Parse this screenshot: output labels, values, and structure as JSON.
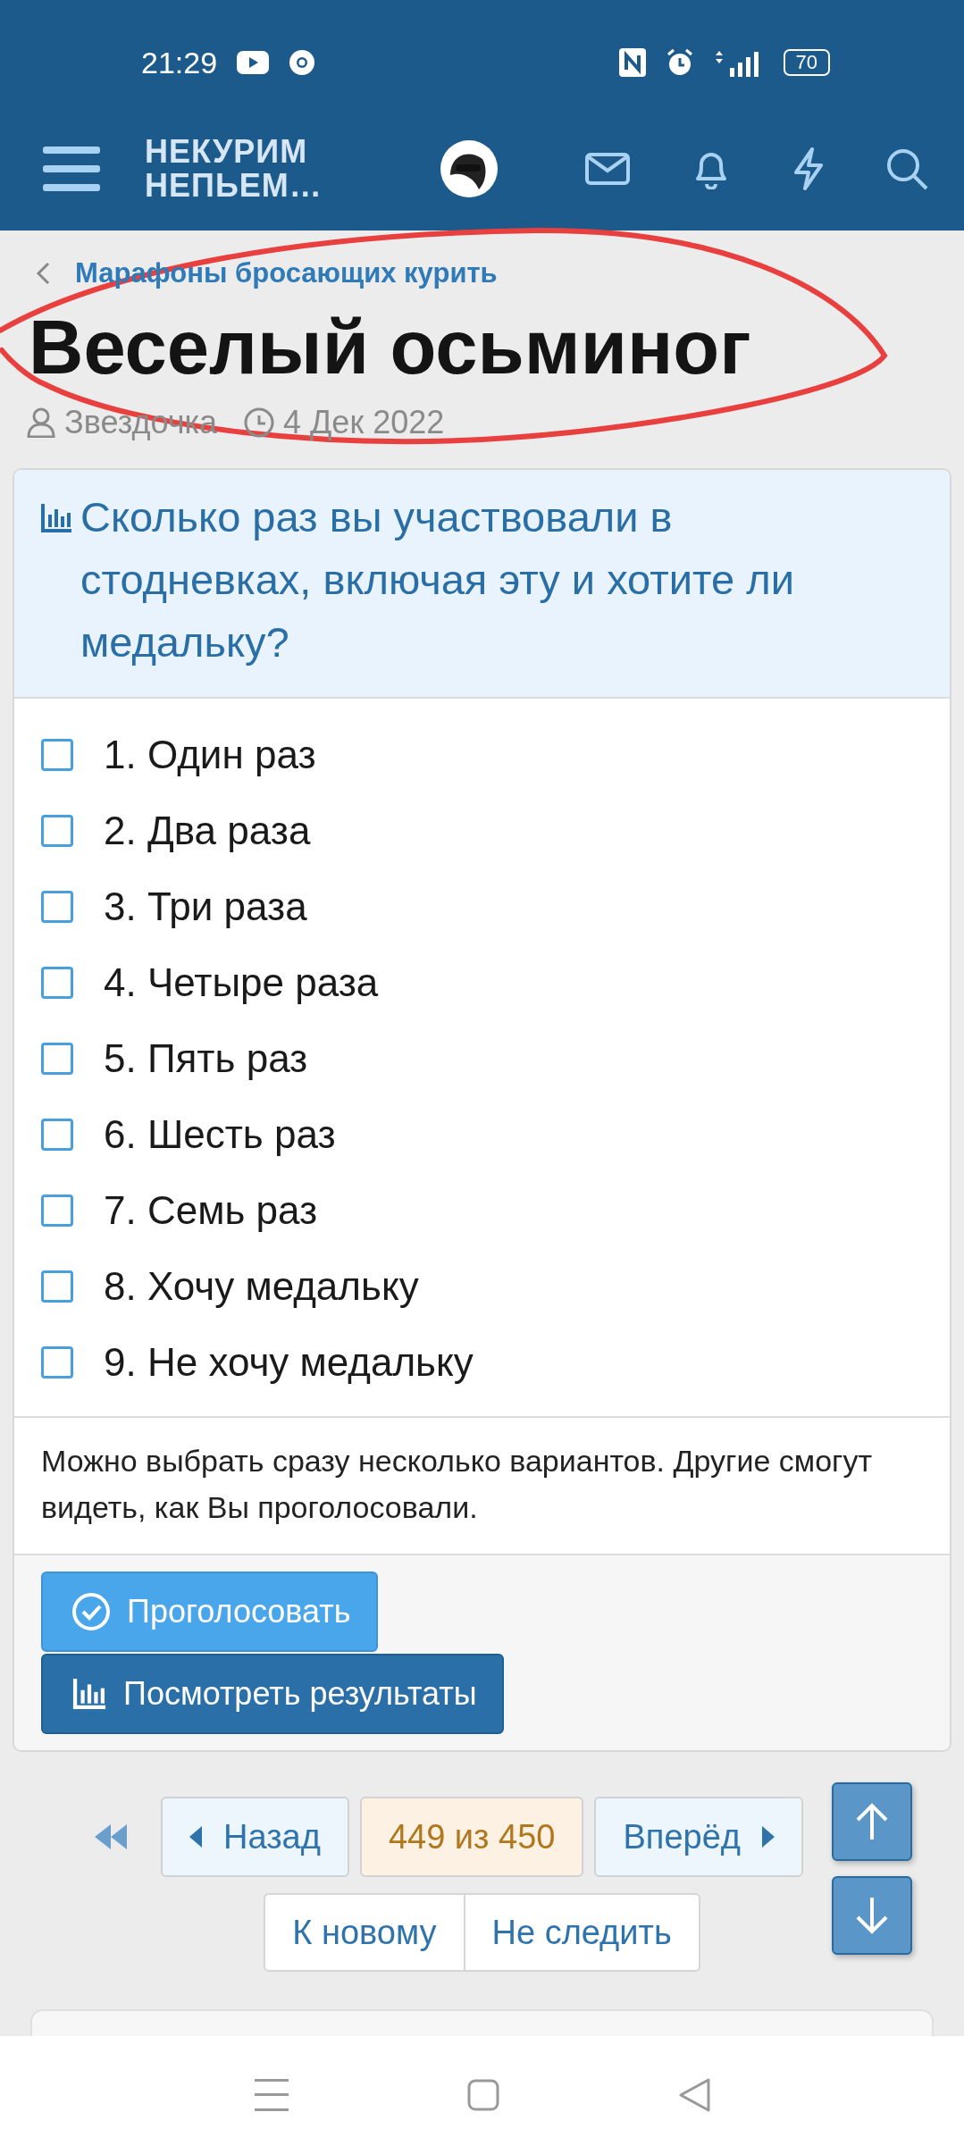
{
  "status_bar": {
    "time": "21:29",
    "battery": "70"
  },
  "header": {
    "logo": "НЕКУРИМ НЕПЬЕМ…"
  },
  "breadcrumb": "Марафоны бросающих курить",
  "title": "Веселый осьминог",
  "meta": {
    "author": "Звездочка",
    "date": "4 Дек 2022"
  },
  "poll": {
    "question": "Сколько раз вы участвовали в стодневках, включая эту и хотите ли медальку?",
    "options": [
      {
        "label": "1. Один раз",
        "checked": false
      },
      {
        "label": "2. Два раза",
        "checked": false
      },
      {
        "label": "3. Три раза",
        "checked": false
      },
      {
        "label": "4. Четыре раза",
        "checked": false
      },
      {
        "label": "5. Пять раз",
        "checked": false
      },
      {
        "label": "6. Шесть раз",
        "checked": false
      },
      {
        "label": "7. Семь раз",
        "checked": false
      },
      {
        "label": "8. Хочу медальку",
        "checked": false
      },
      {
        "label": "9. Не хочу медальку",
        "checked": false
      }
    ],
    "note": "Можно выбрать сразу несколько вариантов. Другие смогут видеть, как Вы проголосовали.",
    "vote_button": "Проголосовать",
    "results_button": "Посмотреть результаты"
  },
  "pagination": {
    "prev": "Назад",
    "page": "449 из 450",
    "next": "Вперёд"
  },
  "thread_actions": [
    "К новому",
    "Не следить"
  ]
}
